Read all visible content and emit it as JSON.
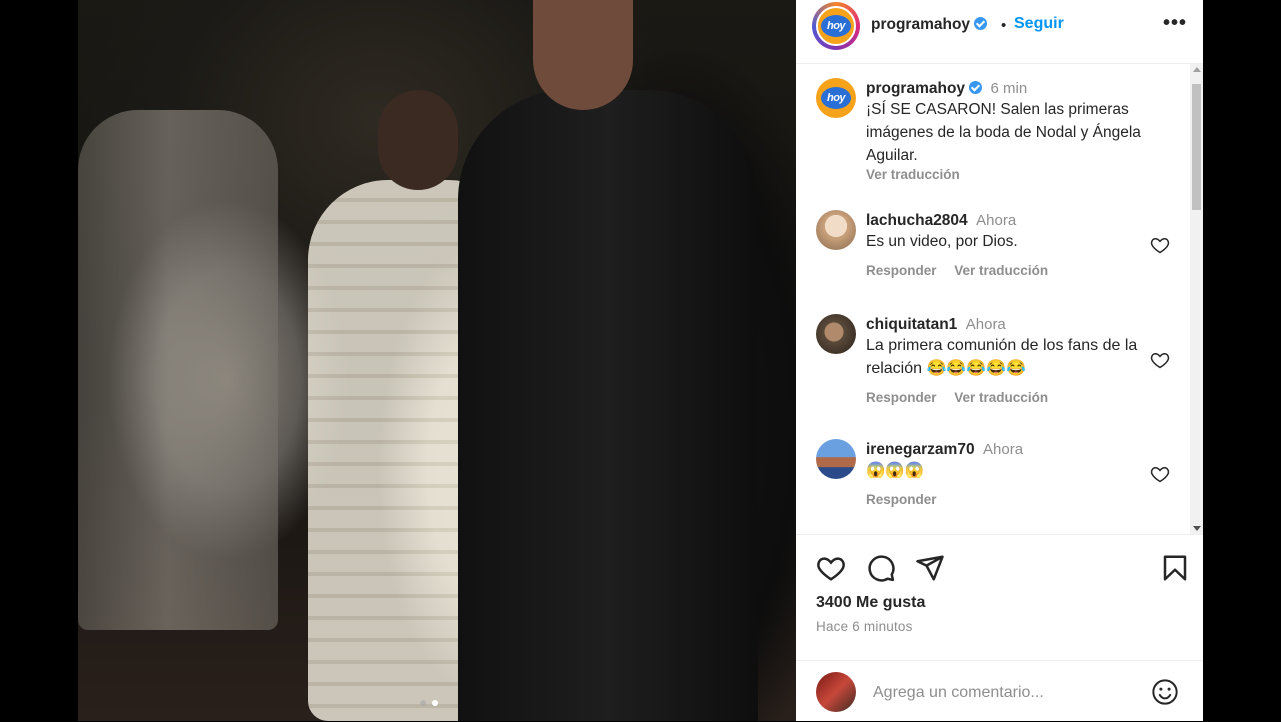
{
  "post": {
    "username": "programahoy",
    "follow_label": "Seguir",
    "separator": "•",
    "more_label": "•••",
    "logo_text": "hoy",
    "slide_count": 2,
    "active_slide": 2
  },
  "caption": {
    "username": "programahoy",
    "time": "6 min",
    "text": "¡SÍ SE CASARON! Salen las primeras imágenes de la boda de Nodal y Ángela Aguilar.",
    "translate": "Ver traducción"
  },
  "comments": [
    {
      "username": "lachucha2804",
      "time": "Ahora",
      "text": "Es un video, por Dios.",
      "reply": "Responder",
      "translate": "Ver traducción",
      "avatar_color": "#d9c2a6"
    },
    {
      "username": "chiquitatan1",
      "time": "Ahora",
      "text": "La primera comunión de los fans de la relación 😂😂😂😂😂",
      "reply": "Responder",
      "translate": "Ver traducción",
      "avatar_color": "#5a4a3a"
    },
    {
      "username": "irenegarzam70",
      "time": "Ahora",
      "text": "😱😱😱",
      "reply": "Responder",
      "avatar_color": "#3a6bc8"
    }
  ],
  "actions": {
    "likes": "3400 Me gusta",
    "posted": "Hace 6 minutos",
    "icons": [
      "heart-icon",
      "comment-icon",
      "share-icon",
      "bookmark-icon"
    ]
  },
  "add_comment": {
    "placeholder": "Agrega un comentario...",
    "emoji_icon": "smiley-icon"
  },
  "colors": {
    "link": "#0095f6",
    "verified": "#3897f0",
    "muted": "#8e8e8e",
    "text": "#262626"
  }
}
